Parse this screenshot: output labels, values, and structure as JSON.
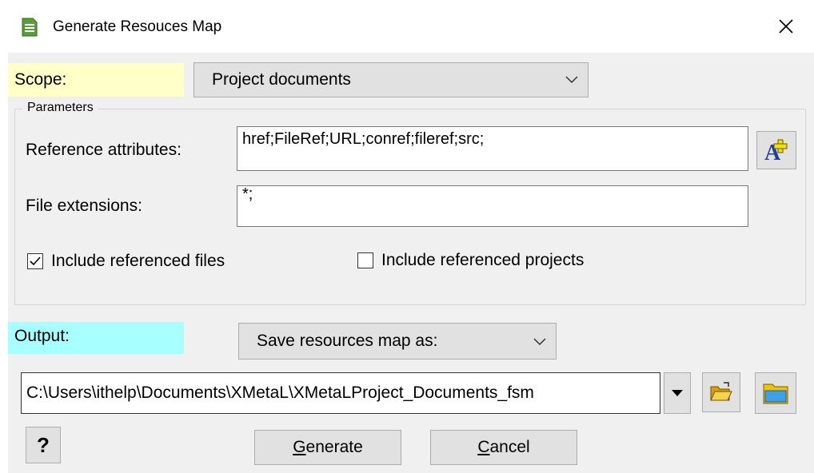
{
  "window": {
    "title": "Generate Resouces Map",
    "title_icon": "document-icon",
    "close_glyph": "✕"
  },
  "scope": {
    "label": "Scope:",
    "selected": "Project documents",
    "highlight_color": "#ffffc8"
  },
  "parameters": {
    "legend": "Parameters",
    "reference_attributes_label": "Reference attributes:",
    "reference_attributes_value": "href;FileRef;URL;conref;fileref;src;",
    "file_extensions_label": "File extensions:",
    "file_extensions_value": "*;",
    "include_referenced_files_label": "Include referenced files",
    "include_referenced_files_checked": true,
    "include_referenced_projects_label": "Include referenced projects",
    "include_referenced_projects_checked": false,
    "font_button_icon": "font-add-icon"
  },
  "output": {
    "label": "Output:",
    "selected": "Save resources map as:",
    "highlight_color": "#a8ffff",
    "path": "C:\\Users\\ithelp\\Documents\\XMetaL\\XMetaLProject_Documents_fsm"
  },
  "buttons": {
    "help_label": "?",
    "generate_label": "Generate",
    "cancel_label": "Cancel"
  }
}
